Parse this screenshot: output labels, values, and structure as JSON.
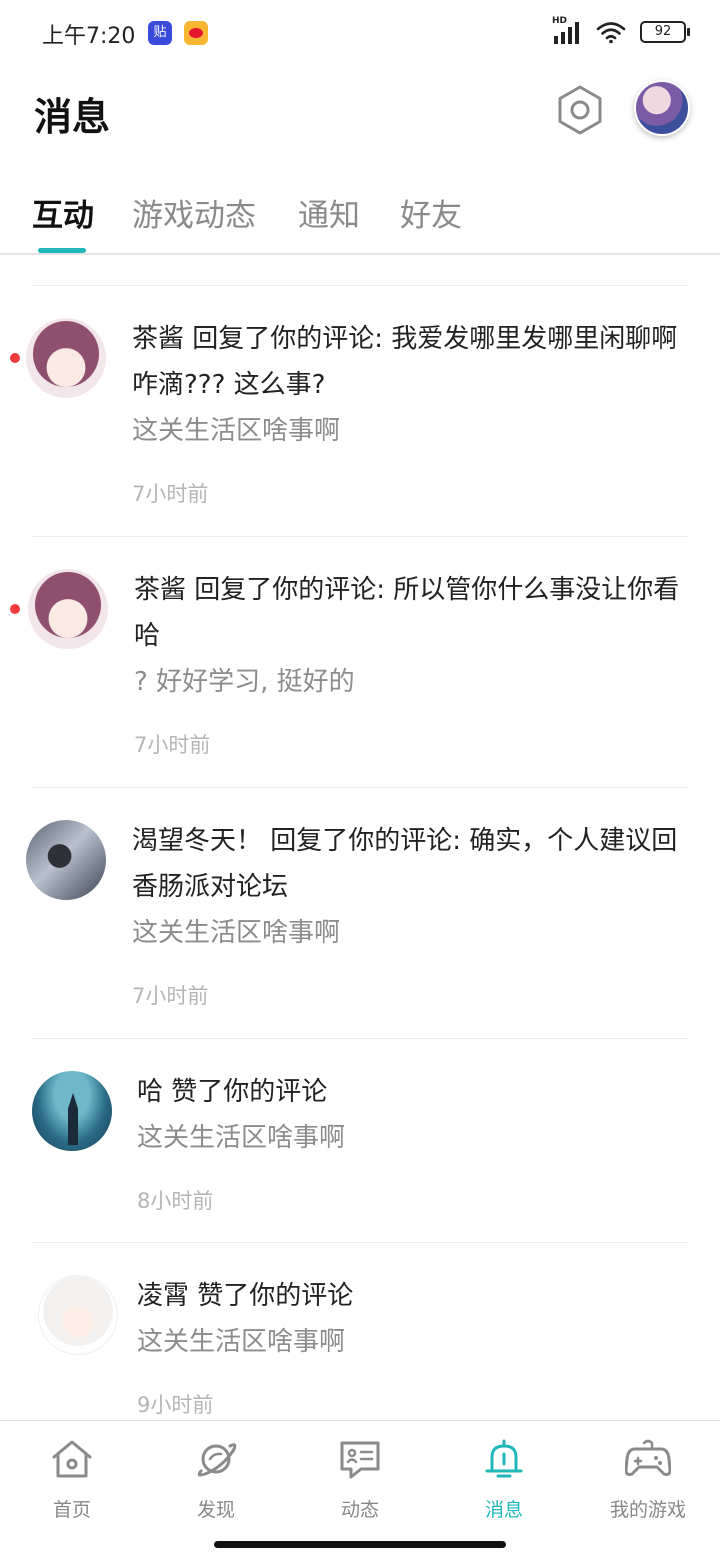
{
  "status_bar": {
    "time": "上午7:20",
    "tieba_badge": "贴",
    "battery": "92",
    "signal_label": "HD"
  },
  "header": {
    "title": "消息"
  },
  "tabs": [
    {
      "label": "互动",
      "active": true
    },
    {
      "label": "游戏动态",
      "active": false
    },
    {
      "label": "通知",
      "active": false
    },
    {
      "label": "好友",
      "active": false
    }
  ],
  "messages": [
    {
      "text": "茶酱 回复了你的评论: 我爱发哪里发哪里闲聊啊咋滴??? 这么事?",
      "quote": "这关生活区啥事啊",
      "time": "7小时前",
      "unread": true
    },
    {
      "text": "茶酱 回复了你的评论: 所以管你什么事没让你看哈",
      "quote": "? 好好学习, 挺好的",
      "time": "7小时前",
      "unread": true
    },
    {
      "text": "渴望冬天！ 回复了你的评论: 确实，个人建议回香肠派对论坛",
      "quote": "这关生活区啥事啊",
      "time": "7小时前",
      "unread": false
    },
    {
      "text": "哈 赞了你的评论",
      "quote": "这关生活区啥事啊",
      "time": "8小时前",
      "unread": false
    },
    {
      "text": "凌霄 赞了你的评论",
      "quote": "这关生活区啥事啊",
      "time": "9小时前",
      "unread": false
    }
  ],
  "bottom_nav": [
    {
      "label": "首页",
      "icon": "home-icon",
      "active": false
    },
    {
      "label": "发现",
      "icon": "planet-icon",
      "active": false
    },
    {
      "label": "动态",
      "icon": "chat-card-icon",
      "active": false
    },
    {
      "label": "消息",
      "icon": "bell-icon",
      "active": true
    },
    {
      "label": "我的游戏",
      "icon": "gamepad-icon",
      "active": false
    }
  ],
  "colors": {
    "accent": "#20b8b8",
    "unread_dot": "#ef3b3b",
    "muted_text": "#8c8c8c",
    "time_text": "#b5b5b5"
  }
}
